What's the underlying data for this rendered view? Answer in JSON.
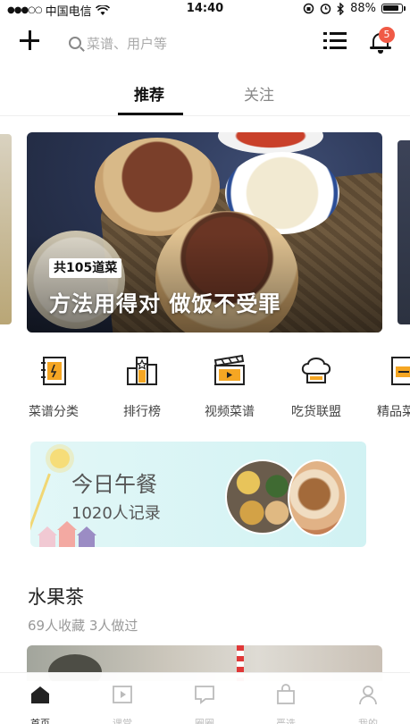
{
  "status_bar": {
    "carrier": "中国电信",
    "time": "14:40",
    "battery": "88%",
    "battery_level": 0.88
  },
  "header": {
    "search_placeholder": "菜谱、用户等",
    "notification_count": "5"
  },
  "tabs": [
    {
      "label": "推荐",
      "active": true
    },
    {
      "label": "关注",
      "active": false
    }
  ],
  "banner": {
    "tag": "共105道菜",
    "headline": "方法用得对 做饭不受罪"
  },
  "categories": [
    {
      "label": "菜谱分类",
      "icon": "recipe-book-icon"
    },
    {
      "label": "排行榜",
      "icon": "ranking-icon"
    },
    {
      "label": "视频菜谱",
      "icon": "video-clapper-icon"
    },
    {
      "label": "吃货联盟",
      "icon": "chef-hat-icon"
    },
    {
      "label": "精品菜",
      "icon": "premium-icon"
    }
  ],
  "lunch_card": {
    "title": "今日午餐",
    "subtitle": "1020人记录"
  },
  "recipe": {
    "title": "水果茶",
    "meta": "69人收藏  3人做过"
  },
  "bottom_nav": [
    {
      "label": "首页",
      "icon": "home-icon",
      "active": true
    },
    {
      "label": "课堂",
      "icon": "play-icon",
      "active": false
    },
    {
      "label": "圈圈",
      "icon": "chat-icon",
      "active": false
    },
    {
      "label": "严选",
      "icon": "shopping-bag-icon",
      "active": false
    },
    {
      "label": "我的",
      "icon": "person-icon",
      "active": false
    }
  ],
  "colors": {
    "accent": "#f5a623",
    "badge": "#f05a46",
    "text_dark": "#111111",
    "text_muted": "#999999"
  }
}
